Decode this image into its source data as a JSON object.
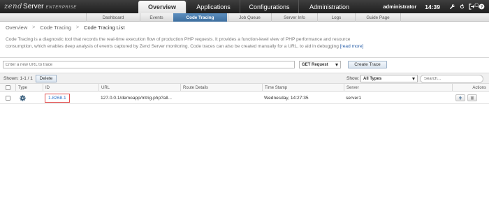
{
  "header": {
    "logo": {
      "zend": "zend",
      "server": "Server",
      "edition": "ENTERPRISE"
    },
    "nav": [
      {
        "label": "Overview",
        "active": true
      },
      {
        "label": "Applications",
        "active": false
      },
      {
        "label": "Configurations",
        "active": false
      },
      {
        "label": "Administration",
        "active": false
      }
    ],
    "user": "administrator",
    "time": "14:39",
    "icons": [
      "settings-wrench-icon",
      "refresh-icon",
      "logout-icon",
      "help-icon"
    ]
  },
  "subnav": [
    {
      "label": "Dashboard",
      "active": false
    },
    {
      "label": "Events",
      "active": false
    },
    {
      "label": "Code Tracing",
      "active": true
    },
    {
      "label": "Job Queue",
      "active": false
    },
    {
      "label": "Server Info",
      "active": false
    },
    {
      "label": "Logs",
      "active": false
    },
    {
      "label": "Guide Page",
      "active": false
    }
  ],
  "breadcrumb": {
    "items": [
      "Overview",
      "Code Tracing"
    ],
    "current": "Code Tracing List",
    "separator": ">"
  },
  "description": {
    "text": "Code Tracing is a diagnostic tool that records the real-time execution flow of production PHP requests. It provides a function-level view of PHP performance and resource consumption, which enables deep analysis of events captured by Zend Server monitoring. Code traces can also be created manually for a URL, to aid in debugging",
    "link": "[read more]"
  },
  "trace_form": {
    "url_placeholder": "Enter a new URL to trace",
    "method_value": "GET Request",
    "create_label": "Create Trace"
  },
  "toolbar": {
    "shown": "Shown: 1-1 / 1",
    "delete_label": "Delete",
    "show_label": "Show:",
    "types_value": "All Types",
    "search_placeholder": "Search..."
  },
  "table": {
    "columns": [
      "Type",
      "ID",
      "URL",
      "Route Details",
      "Time Stamp",
      "Server",
      "Actions"
    ],
    "rows": [
      {
        "type_icon": "gear-icon",
        "id": "1.8268.1",
        "url": "127.0.0.1/demoapp/mtrig.php?all...",
        "route": "",
        "timestamp": "Wednesday, 14:27:35",
        "server": "server1"
      }
    ]
  },
  "colors": {
    "topbar": "#2d2d2d",
    "subnav_active": "#4a7cab",
    "link": "#2a6fc7",
    "highlight_border": "#e05050"
  }
}
